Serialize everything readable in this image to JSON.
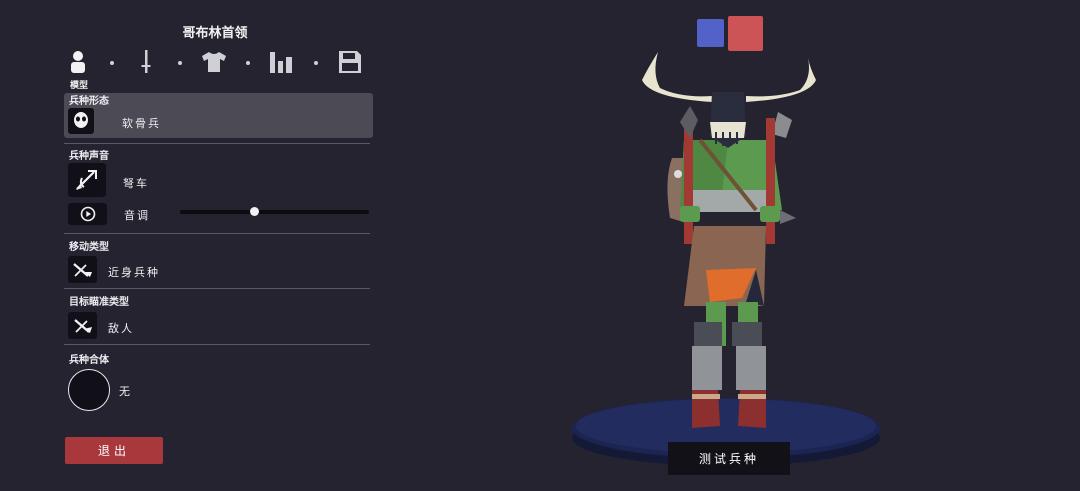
{
  "header": {
    "title": "哥布林首领"
  },
  "tabs": {
    "active_label": "模型",
    "items": [
      {
        "name": "model",
        "icon": "person-icon"
      },
      {
        "name": "weapon",
        "icon": "sword-icon"
      },
      {
        "name": "clothing",
        "icon": "shirt-icon"
      },
      {
        "name": "stats",
        "icon": "bar-chart-icon"
      },
      {
        "name": "save",
        "icon": "save-icon"
      }
    ]
  },
  "unit_form": {
    "label": "兵种形态",
    "value": "软骨兵",
    "icon": "skull-mask-icon"
  },
  "unit_voice": {
    "label": "兵种声音",
    "value": "弩车",
    "icon": "crossbow-icon",
    "pitch_label": "音调",
    "pitch_level": 0.39
  },
  "movement": {
    "label": "移动类型",
    "value": "近身兵种",
    "icon": "melee-icon"
  },
  "targeting": {
    "label": "目标瞄准类型",
    "value": "敌人",
    "icon": "target-enemy-icon"
  },
  "combine": {
    "label": "兵种合体",
    "value": "无"
  },
  "buttons": {
    "exit": "退出",
    "test": "测试兵种"
  },
  "colors": {
    "team_blue": "#5362c8",
    "team_red": "#cc5356",
    "exit_red": "#a8383c",
    "panel_selected": "#4b4a55",
    "background": "#252330"
  }
}
